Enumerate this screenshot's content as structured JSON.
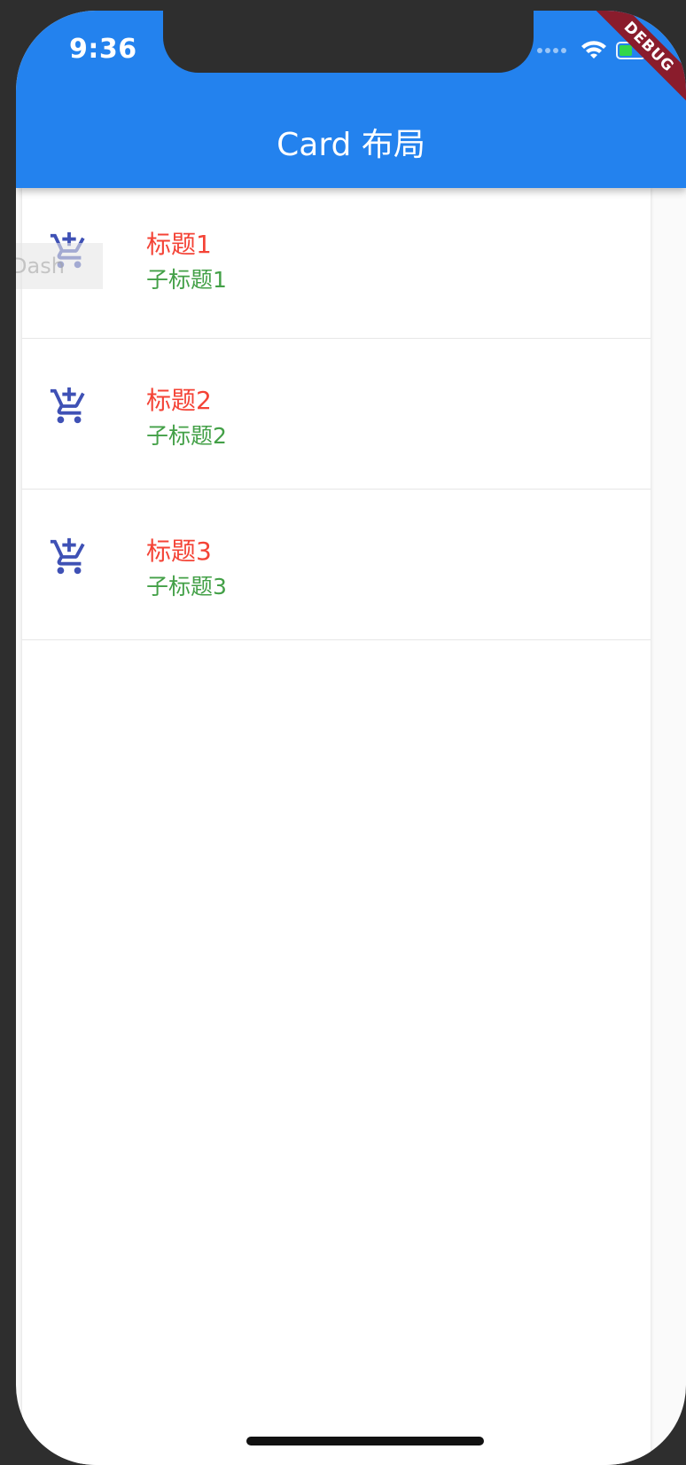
{
  "status_bar": {
    "time": "9:36",
    "icons": [
      "signal-dots-icon",
      "wifi-icon",
      "battery-charging-icon"
    ],
    "debug_banner": "DEBUG"
  },
  "app_bar": {
    "title": "Card 布局",
    "color": "#2382ee"
  },
  "overlay": {
    "floating_label": "Dash"
  },
  "list": {
    "icon": "add-shopping-cart-icon",
    "icon_color": "#3f51b5",
    "title_color": "#f44336",
    "subtitle_color": "#43a047",
    "items": [
      {
        "title": "标题1",
        "subtitle": "子标题1"
      },
      {
        "title": "标题2",
        "subtitle": "子标题2"
      },
      {
        "title": "标题3",
        "subtitle": "子标题3"
      }
    ]
  }
}
